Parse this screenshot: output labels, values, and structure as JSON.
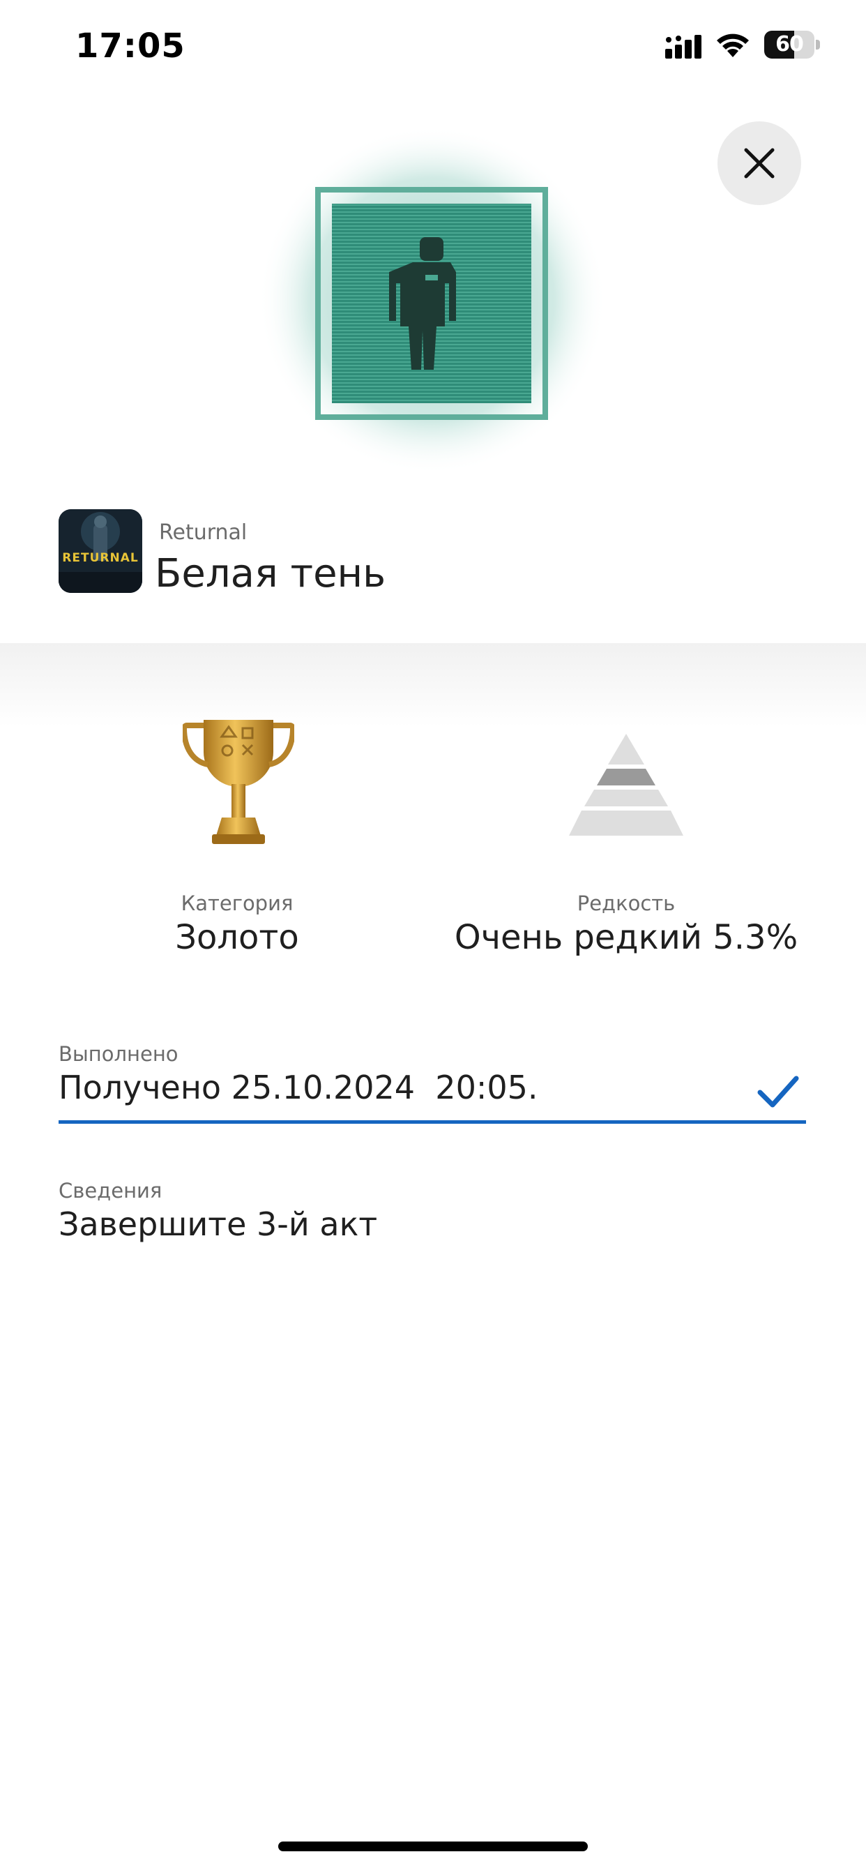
{
  "status_bar": {
    "time": "17:05",
    "battery": "60",
    "battery_level": 0.6
  },
  "trophy": {
    "game": "Returnal",
    "name": "Белая тень",
    "game_thumb_logo": "RETURNAL",
    "art_color": "#3f9a86"
  },
  "stats": {
    "category_label": "Категория",
    "category_value": "Золото",
    "rarity_label": "Редкость",
    "rarity_value": "Очень редкий 5.3%"
  },
  "earned": {
    "label": "Выполнено",
    "value": "Получено 25.10.2024  20:05."
  },
  "details": {
    "label": "Сведения",
    "value": "Завершите 3-й акт"
  },
  "colors": {
    "accent": "#1565c0",
    "gold": "#c9962c",
    "text": "#1f1f1f",
    "muted": "#6b6b6b"
  },
  "icons": [
    "close-icon",
    "cellular-signal-icon",
    "wifi-icon",
    "battery-icon",
    "gold-trophy-icon",
    "rarity-pyramid-icon",
    "checkmark-icon"
  ]
}
